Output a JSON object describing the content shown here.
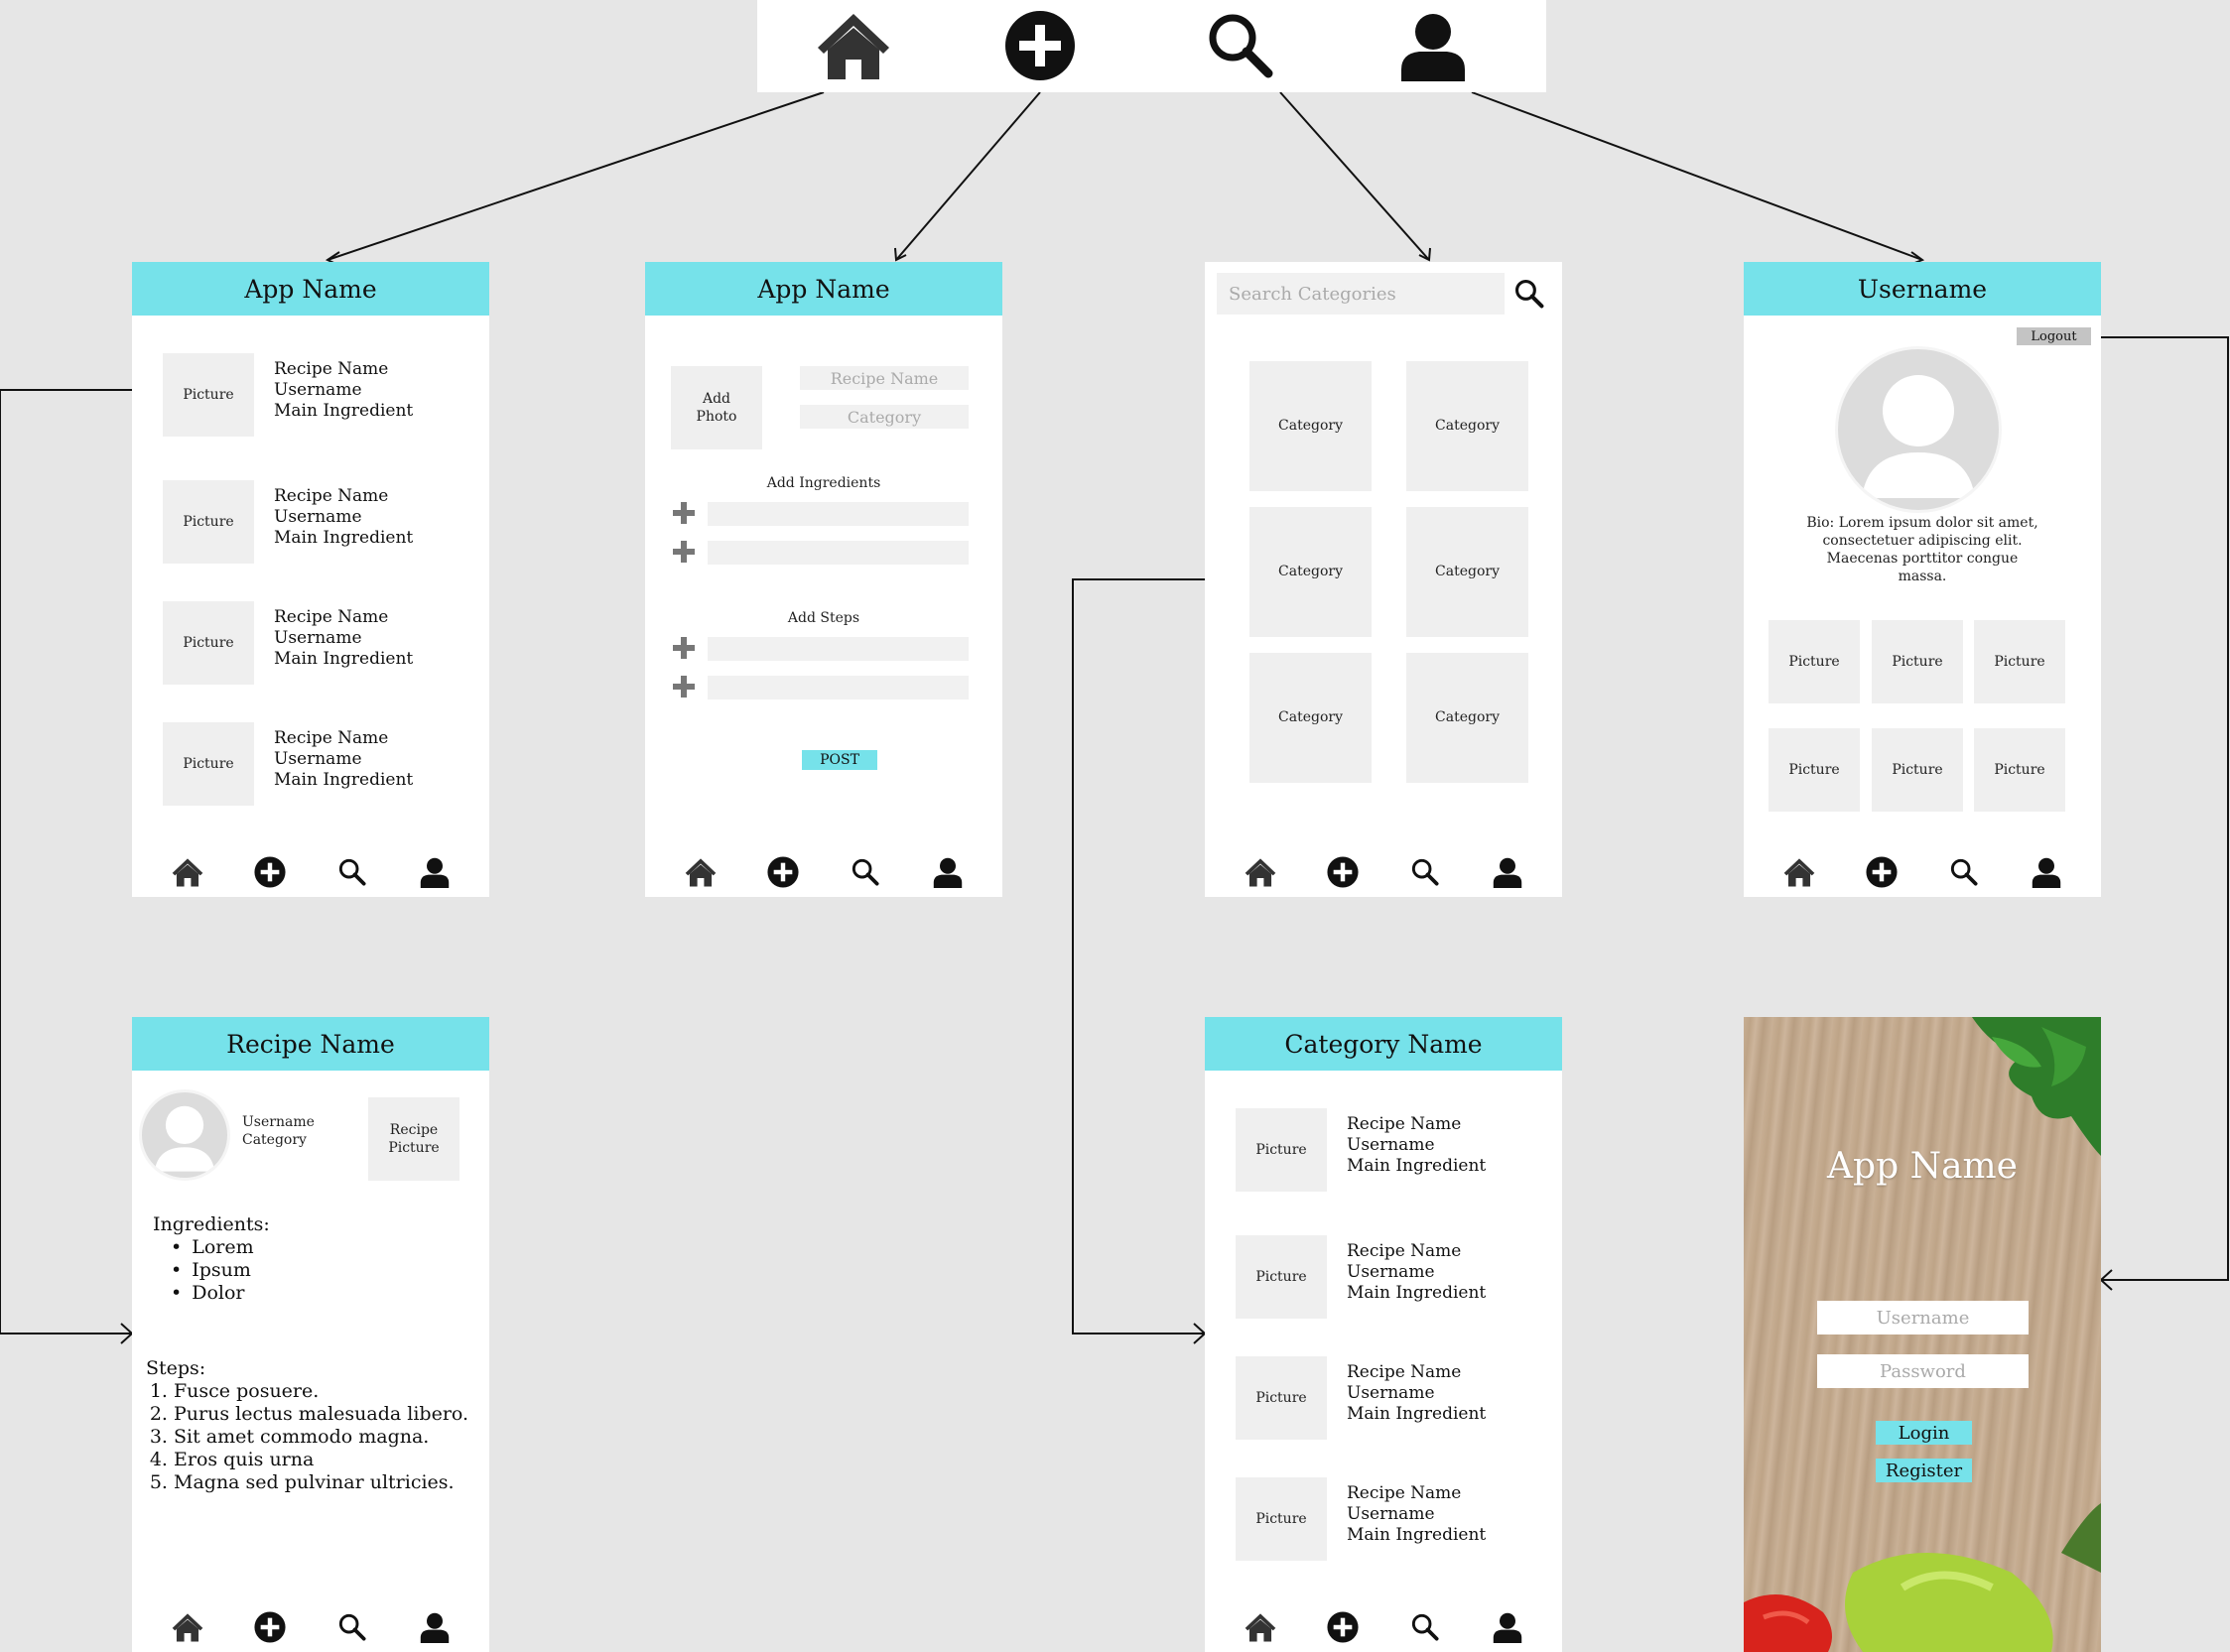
{
  "topnav": {
    "icons": [
      "home-icon",
      "add-circle-icon",
      "search-icon",
      "user-icon"
    ]
  },
  "home": {
    "title": "App Name",
    "items": [
      {
        "picture": "Picture",
        "recipe": "Recipe Name",
        "user": "Username",
        "ingredient": "Main Ingredient"
      },
      {
        "picture": "Picture",
        "recipe": "Recipe Name",
        "user": "Username",
        "ingredient": "Main Ingredient"
      },
      {
        "picture": "Picture",
        "recipe": "Recipe Name",
        "user": "Username",
        "ingredient": "Main Ingredient"
      },
      {
        "picture": "Picture",
        "recipe": "Recipe Name",
        "user": "Username",
        "ingredient": "Main Ingredient"
      }
    ]
  },
  "add": {
    "title": "App Name",
    "add_photo": "Add Photo",
    "recipe_placeholder": "Recipe Name",
    "category_placeholder": "Category",
    "ingredients_label": "Add Ingredients",
    "steps_label": "Add Steps",
    "post_label": "POST"
  },
  "search": {
    "placeholder": "Search Categories",
    "categories": [
      "Category",
      "Category",
      "Category",
      "Category",
      "Category",
      "Category"
    ]
  },
  "profile": {
    "title": "Username",
    "logout": "Logout",
    "bio": "Bio: Lorem ipsum dolor sit amet, consectetuer adipiscing elit. Maecenas porttitor congue massa.",
    "pictures": [
      "Picture",
      "Picture",
      "Picture",
      "Picture",
      "Picture",
      "Picture"
    ]
  },
  "recipe": {
    "title": "Recipe Name",
    "username": "Username",
    "category": "Category",
    "picture": "Recipe Picture",
    "ingredients_title": "Ingredients:",
    "ingredients": [
      "Lorem",
      "Ipsum",
      "Dolor"
    ],
    "steps_title": "Steps:",
    "steps": [
      "Fusce posuere.",
      "Purus lectus malesuada libero.",
      "Sit amet commodo magna.",
      "Eros quis urna",
      "Magna sed pulvinar ultricies."
    ]
  },
  "category_page": {
    "title": "Category Name",
    "items": [
      {
        "picture": "Picture",
        "recipe": "Recipe Name",
        "user": "Username",
        "ingredient": "Main Ingredient"
      },
      {
        "picture": "Picture",
        "recipe": "Recipe Name",
        "user": "Username",
        "ingredient": "Main Ingredient"
      },
      {
        "picture": "Picture",
        "recipe": "Recipe Name",
        "user": "Username",
        "ingredient": "Main Ingredient"
      },
      {
        "picture": "Picture",
        "recipe": "Recipe Name",
        "user": "Username",
        "ingredient": "Main Ingredient"
      }
    ]
  },
  "login": {
    "title": "App Name",
    "username_placeholder": "Username",
    "password_placeholder": "Password",
    "login_label": "Login",
    "register_label": "Register"
  },
  "colors": {
    "accent": "#76e2ea",
    "background": "#e6e6e6",
    "placeholder": "#efefef"
  }
}
